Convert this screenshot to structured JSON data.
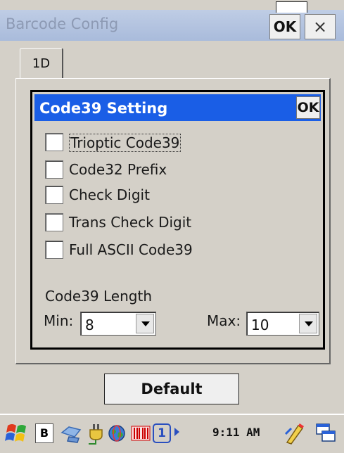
{
  "window": {
    "title": "Barcode Config",
    "ok_label": "OK",
    "close_label": "×"
  },
  "tabs": [
    {
      "label": "1D",
      "selected": true
    }
  ],
  "dialog": {
    "title": "Code39 Setting",
    "ok_label": "OK",
    "options": [
      {
        "label": "Trioptic Code39",
        "checked": false,
        "focused": true
      },
      {
        "label": "Code32 Prefix",
        "checked": false
      },
      {
        "label": "Check Digit",
        "checked": false
      },
      {
        "label": "Trans Check Digit",
        "checked": false
      },
      {
        "label": "Full ASCII Code39",
        "checked": false
      }
    ],
    "length": {
      "label": "Code39 Length",
      "min_label": "Min:",
      "min_value": "8",
      "max_label": "Max:",
      "max_value": "10"
    }
  },
  "default_button": "Default",
  "taskbar": {
    "ime_label": "B",
    "clock": "9:11 AM",
    "input_number": "1"
  },
  "colors": {
    "dialog_title_bg": "#1a5ee6",
    "title_strip": "#a9bbdb",
    "face": "#d4d0c8"
  }
}
